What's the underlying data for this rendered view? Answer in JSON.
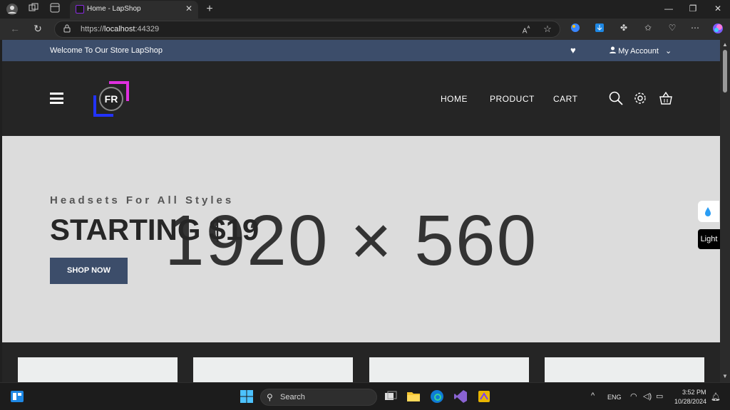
{
  "browser": {
    "tab_title": "Home - LapShop",
    "url_prefix": "https://",
    "url_host": "localhost",
    "url_port": ":44329",
    "close_tab": "✕",
    "new_tab": "+",
    "minimize": "—",
    "restore": "❐",
    "close_window": "✕"
  },
  "site": {
    "topbar": {
      "welcome": "Welcome To Our Store LapShop",
      "account": "My Account",
      "heart_icon": "heart-icon"
    },
    "nav": [
      "HOME",
      "PRODUCT",
      "CART"
    ],
    "logo_text": "FR",
    "hero": {
      "placeholder": "1920 × 560",
      "subtitle": "Headsets For All Styles",
      "headline": "STARTING $19",
      "cta": "SHOP NOW"
    },
    "theme_toggle": "Light"
  },
  "taskbar": {
    "search_placeholder": "Search",
    "lang": "ENG",
    "time": "3:52 PM",
    "date": "10/28/2024"
  },
  "colors": {
    "accent": "#3c4d6a",
    "header_bg": "#252525",
    "hero_bg": "#dcdcdc"
  }
}
